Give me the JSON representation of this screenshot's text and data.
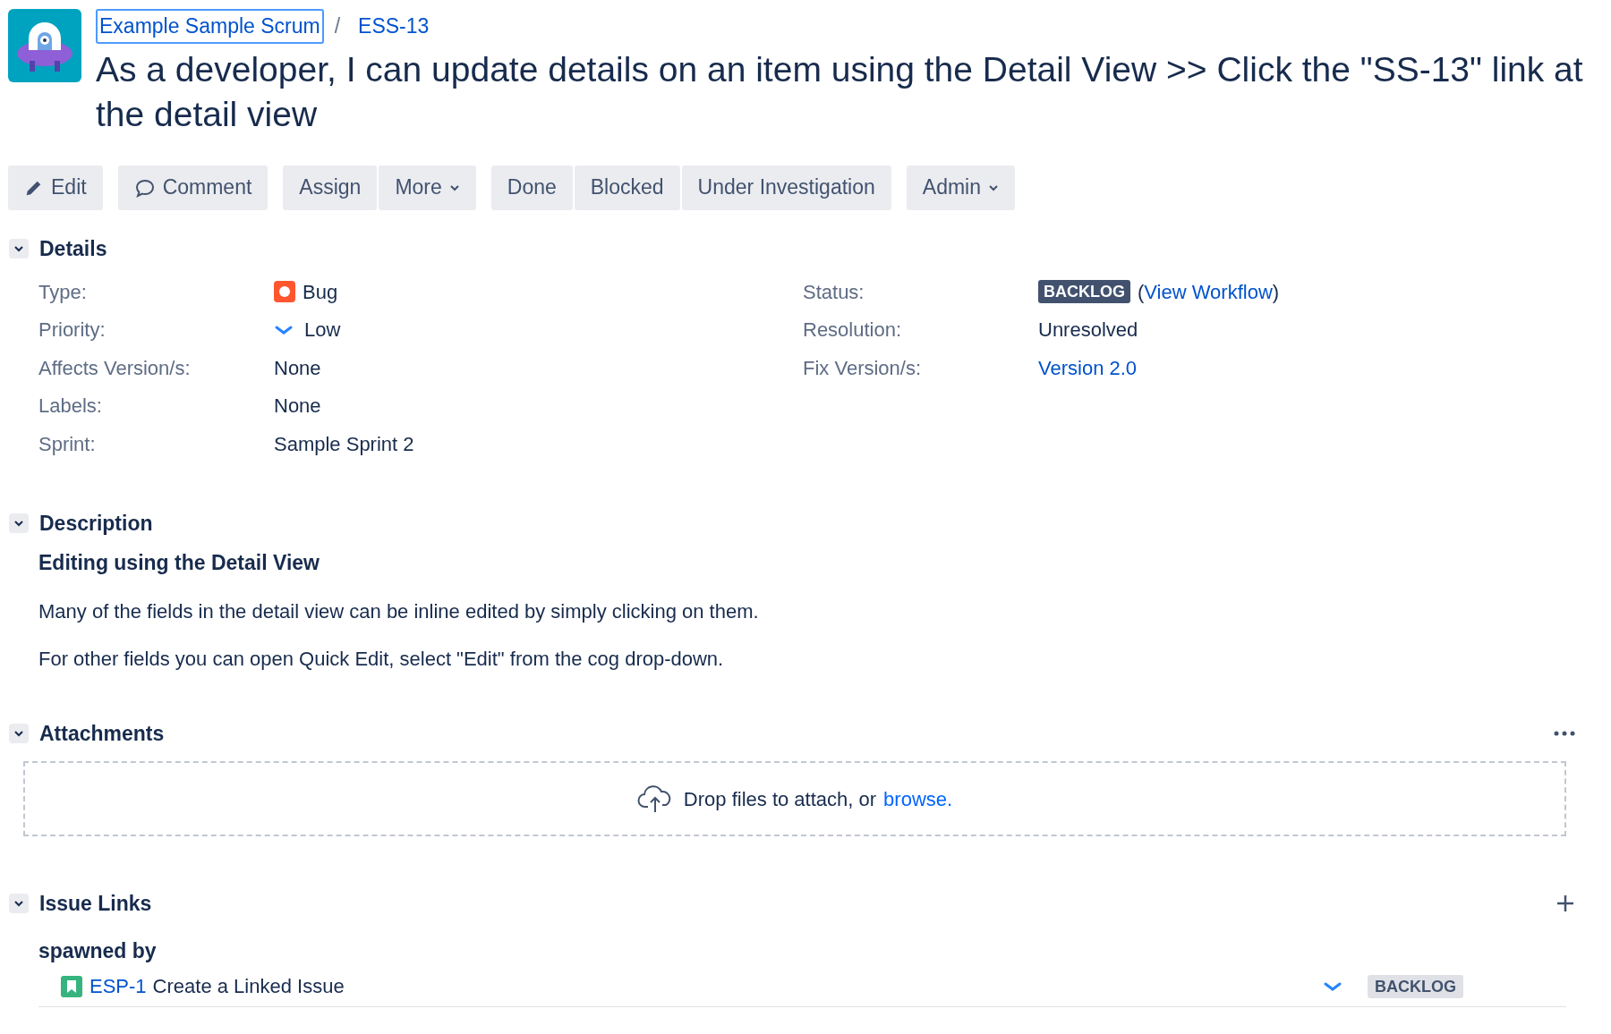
{
  "breadcrumb": {
    "project": "Example Sample Scrum",
    "separator": "/",
    "issue_key": "ESS-13"
  },
  "title": "As a developer, I can update details on an item using the Detail View >> Click the \"SS-13\" link at the detail view",
  "toolbar": [
    {
      "buttons": [
        {
          "kind": "edit",
          "label": "Edit",
          "dropdown": false
        }
      ]
    },
    {
      "buttons": [
        {
          "kind": "comment",
          "label": "Comment",
          "dropdown": false
        }
      ]
    },
    {
      "buttons": [
        {
          "kind": "plain",
          "label": "Assign",
          "dropdown": false
        },
        {
          "kind": "plain",
          "label": "More",
          "dropdown": true
        }
      ]
    },
    {
      "buttons": [
        {
          "kind": "plain",
          "label": "Done",
          "dropdown": false
        },
        {
          "kind": "plain",
          "label": "Blocked",
          "dropdown": false
        },
        {
          "kind": "plain",
          "label": "Under Investigation",
          "dropdown": false
        }
      ]
    },
    {
      "buttons": [
        {
          "kind": "plain",
          "label": "Admin",
          "dropdown": true
        }
      ]
    }
  ],
  "details": {
    "heading": "Details",
    "expanded": true,
    "left": [
      {
        "label": "Type:",
        "value": "Bug",
        "kind": "bug"
      },
      {
        "label": "Priority:",
        "value": "Low",
        "kind": "priority"
      },
      {
        "label": "Affects Version/s:",
        "value": "None",
        "kind": "text"
      },
      {
        "label": "Labels:",
        "value": "None",
        "kind": "text"
      },
      {
        "label": "Sprint:",
        "value": "Sample Sprint 2",
        "kind": "text"
      }
    ],
    "right": [
      {
        "label": "Status:",
        "kind": "status",
        "badge": "BACKLOG",
        "open": "(",
        "link": "View Workflow",
        "close": ")"
      },
      {
        "label": "Resolution:",
        "kind": "text",
        "value": "Unresolved"
      },
      {
        "label": "Fix Version/s:",
        "kind": "link",
        "value": "Version 2.0"
      }
    ]
  },
  "description": {
    "heading": "Description",
    "expanded": true,
    "subheading": "Editing using the Detail View",
    "paragraphs": [
      "Many of the fields in the detail view can be inline edited by simply clicking on them.",
      "For other fields you can open Quick Edit, select \"Edit\" from the cog drop-down."
    ]
  },
  "attachments": {
    "heading": "Attachments",
    "expanded": true,
    "drop_text": "Drop files to attach, or",
    "browse_link": "browse."
  },
  "issue_links": {
    "heading": "Issue Links",
    "expanded": true,
    "group": "spawned by",
    "links": [
      {
        "key": "ESP-1",
        "summary": "Create a Linked Issue",
        "status": "BACKLOG"
      }
    ]
  }
}
